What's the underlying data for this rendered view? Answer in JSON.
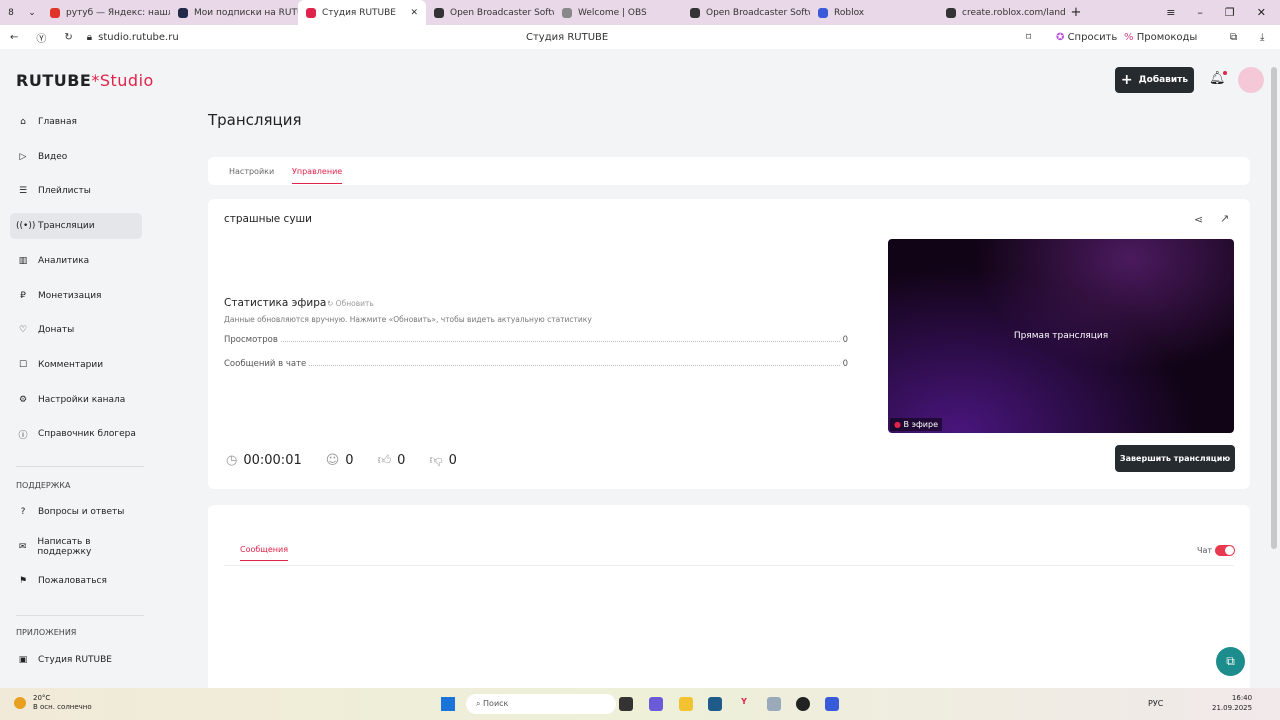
{
  "browser": {
    "tab_count": "8",
    "tabs": [
      {
        "title": "рутуб — Яндекс: нашло",
        "color": "#e0342b"
      },
      {
        "title": "Мои подписки на RUTUBE",
        "color": "#222a4a"
      },
      {
        "title": "Студия RUTUBE",
        "color": "#e0234b",
        "active": true
      },
      {
        "title": "Open Broadcaster Softwa",
        "color": "#333"
      },
      {
        "title": "Welcome | OBS",
        "color": "#888"
      },
      {
        "title": "Open Broadcaster Softwa",
        "color": "#333"
      },
      {
        "title": "Roblox",
        "color": "#3a5bd9"
      },
      {
        "title": "create.roblox.com/landin",
        "color": "#333"
      }
    ],
    "url": "studio.rutube.ru",
    "page_title": "Студия RUTUBE",
    "ask": "Спросить",
    "promo": "Промокоды"
  },
  "app": {
    "logo_main": "RUTUBE",
    "logo_sub": "Studio",
    "add_button": "Добавить",
    "accent": "#e0234b",
    "nav": [
      {
        "label": "Главная"
      },
      {
        "label": "Видео"
      },
      {
        "label": "Плейлисты"
      },
      {
        "label": "Трансляции",
        "active": true
      },
      {
        "label": "Аналитика"
      },
      {
        "label": "Монетизация"
      },
      {
        "label": "Донаты"
      },
      {
        "label": "Комментарии"
      },
      {
        "label": "Настройки канала"
      },
      {
        "label": "Справочник блогера"
      }
    ],
    "support_title": "ПОДДЕРЖКА",
    "support": [
      {
        "label": "Вопросы и ответы"
      },
      {
        "label": "Написать в поддержку"
      },
      {
        "label": "Пожаловаться"
      }
    ],
    "apps_title": "ПРИЛОЖЕНИЯ",
    "apps": [
      {
        "label": "Студия RUTUBE"
      }
    ]
  },
  "main": {
    "title": "Трансляция",
    "tabs": [
      {
        "label": "Настройки"
      },
      {
        "label": "Управление",
        "active": true
      }
    ],
    "stream_name": "страшные суши",
    "stats_title": "Статистика эфира",
    "refresh": "Обновить",
    "stats_note": "Данные обновляются вручную. Нажмите «Обновить», чтобы видеть актуальную статистику",
    "stats": [
      {
        "label": "Просмотров",
        "value": "0"
      },
      {
        "label": "Сообщений в чате",
        "value": "0"
      }
    ],
    "duration": "00:00:01",
    "viewers": "0",
    "likes": "0",
    "dislikes": "0",
    "preview_text": "Прямая трансляция",
    "live_badge": "В эфире",
    "end_button": "Завершить трансляцию",
    "chat_tab": "Сообщения",
    "chat_toggle_label": "Чат",
    "chat_enabled": true
  },
  "taskbar": {
    "weather_temp": "20°C",
    "weather_desc": "В осн. солнечно",
    "search": "Поиск",
    "lang": "РУС",
    "time": "16:40",
    "date": "21.09.2025"
  }
}
